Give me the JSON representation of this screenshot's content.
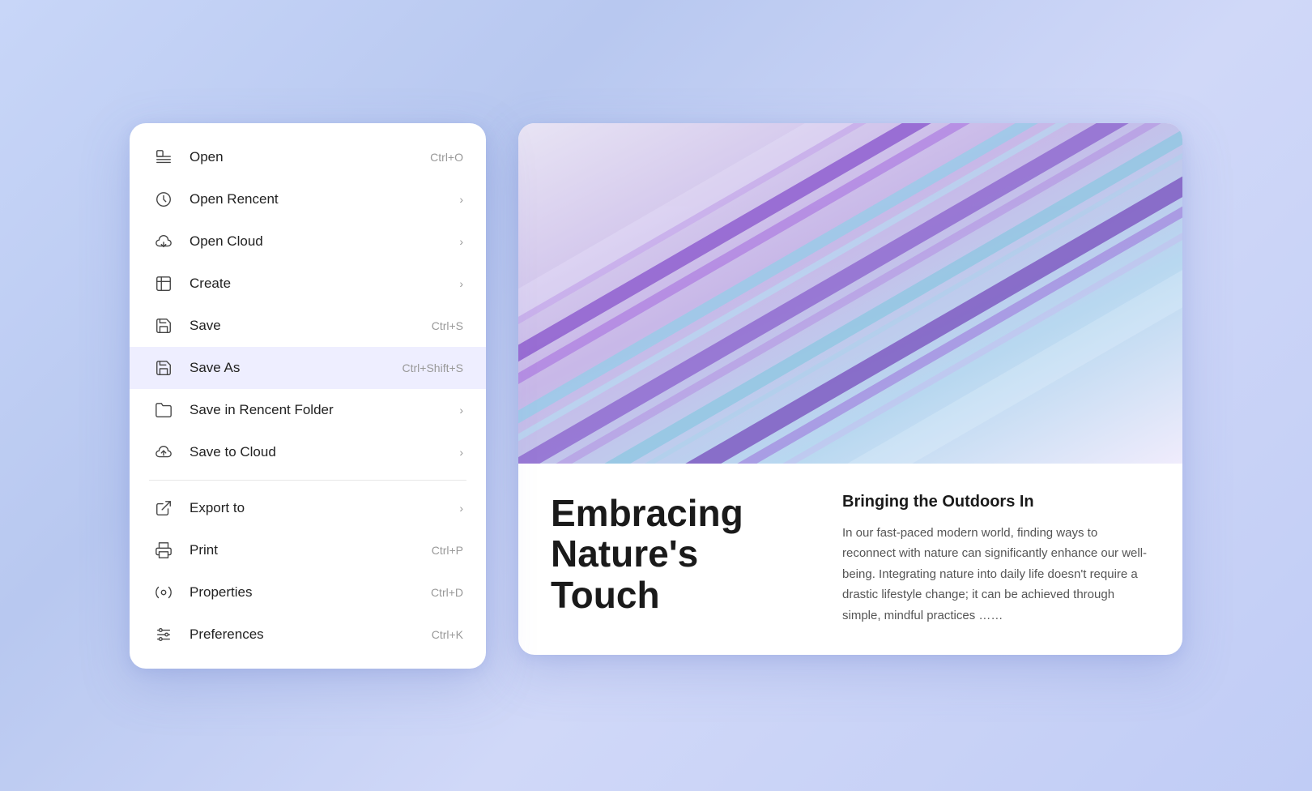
{
  "menu": {
    "items": [
      {
        "id": "open",
        "label": "Open",
        "shortcut": "Ctrl+O",
        "hasArrow": false,
        "icon": "open-icon",
        "active": false,
        "dividerAfter": false
      },
      {
        "id": "open-recent",
        "label": "Open Rencent",
        "shortcut": "",
        "hasArrow": true,
        "icon": "open-recent-icon",
        "active": false,
        "dividerAfter": false
      },
      {
        "id": "open-cloud",
        "label": "Open Cloud",
        "shortcut": "",
        "hasArrow": true,
        "icon": "cloud-download-icon",
        "active": false,
        "dividerAfter": false
      },
      {
        "id": "create",
        "label": "Create",
        "shortcut": "",
        "hasArrow": true,
        "icon": "create-icon",
        "active": false,
        "dividerAfter": false
      },
      {
        "id": "save",
        "label": "Save",
        "shortcut": "Ctrl+S",
        "hasArrow": false,
        "icon": "save-icon",
        "active": false,
        "dividerAfter": false
      },
      {
        "id": "save-as",
        "label": "Save As",
        "shortcut": "Ctrl+Shift+S",
        "hasArrow": false,
        "icon": "save-as-icon",
        "active": true,
        "dividerAfter": false
      },
      {
        "id": "save-recent-folder",
        "label": "Save in Rencent Folder",
        "shortcut": "",
        "hasArrow": true,
        "icon": "folder-icon",
        "active": false,
        "dividerAfter": false
      },
      {
        "id": "save-cloud",
        "label": "Save to Cloud",
        "shortcut": "",
        "hasArrow": true,
        "icon": "cloud-upload-icon",
        "active": false,
        "dividerAfter": true
      },
      {
        "id": "export",
        "label": "Export to",
        "shortcut": "",
        "hasArrow": true,
        "icon": "export-icon",
        "active": false,
        "dividerAfter": false
      },
      {
        "id": "print",
        "label": "Print",
        "shortcut": "Ctrl+P",
        "hasArrow": false,
        "icon": "print-icon",
        "active": false,
        "dividerAfter": false
      },
      {
        "id": "properties",
        "label": "Properties",
        "shortcut": "Ctrl+D",
        "hasArrow": false,
        "icon": "properties-icon",
        "active": false,
        "dividerAfter": false
      },
      {
        "id": "preferences",
        "label": "Preferences",
        "shortcut": "Ctrl+K",
        "hasArrow": false,
        "icon": "preferences-icon",
        "active": false,
        "dividerAfter": false
      }
    ]
  },
  "document": {
    "title": "Embracing Nature's Touch",
    "article_heading": "Bringing the Outdoors In",
    "article_body": "In our fast-paced modern world, finding ways to reconnect with nature can significantly enhance our well-being. Integrating nature into daily life doesn't require a drastic lifestyle change; it can be achieved through simple, mindful practices ……"
  }
}
